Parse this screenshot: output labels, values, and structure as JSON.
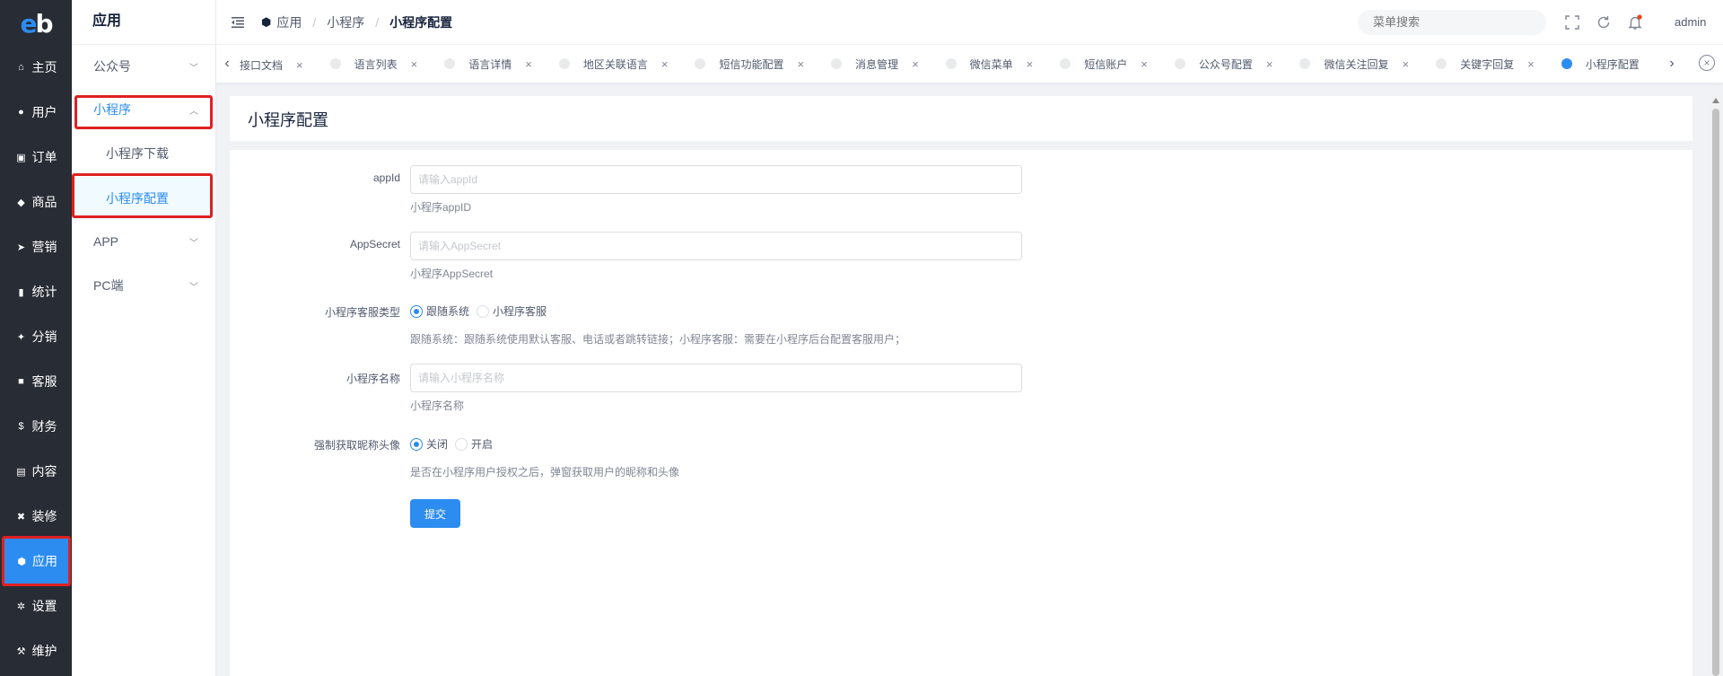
{
  "logo": {
    "text_e": "e",
    "text_b": "b"
  },
  "nav": [
    {
      "label": "主页",
      "icon": "home-icon",
      "glyph": "⌂"
    },
    {
      "label": "用户",
      "icon": "user-icon",
      "glyph": "●"
    },
    {
      "label": "订单",
      "icon": "cart-icon",
      "glyph": "▣"
    },
    {
      "label": "商品",
      "icon": "basket-icon",
      "glyph": "◆"
    },
    {
      "label": "营销",
      "icon": "send-icon",
      "glyph": "➤"
    },
    {
      "label": "统计",
      "icon": "bar-chart-icon",
      "glyph": "▮"
    },
    {
      "label": "分销",
      "icon": "handshake-icon",
      "glyph": "✦"
    },
    {
      "label": "客服",
      "icon": "chat-icon",
      "glyph": "■"
    },
    {
      "label": "财务",
      "icon": "dollar-icon",
      "glyph": "$"
    },
    {
      "label": "内容",
      "icon": "book-icon",
      "glyph": "▤"
    },
    {
      "label": "装修",
      "icon": "tools-icon",
      "glyph": "✖"
    },
    {
      "label": "应用",
      "icon": "cube-icon",
      "glyph": "⬢"
    },
    {
      "label": "设置",
      "icon": "gear-icon",
      "glyph": "✲"
    },
    {
      "label": "维护",
      "icon": "hammer-icon",
      "glyph": "⚒"
    }
  ],
  "subnav": {
    "title": "应用",
    "items": {
      "gongzhonghao": "公众号",
      "miniprogram": "小程序",
      "mp_download": "小程序下载",
      "mp_config": "小程序配置",
      "app": "APP",
      "pc": "PC端"
    }
  },
  "breadcrumb": {
    "b1": "应用",
    "b2": "小程序",
    "b3": "小程序配置",
    "sep": "/"
  },
  "header": {
    "search_placeholder": "菜单搜索",
    "user": "admin"
  },
  "tabs": [
    {
      "label": "接口文档",
      "active": false,
      "dot": false
    },
    {
      "label": "语言列表",
      "active": false,
      "dot": true
    },
    {
      "label": "语言详情",
      "active": false,
      "dot": true
    },
    {
      "label": "地区关联语言",
      "active": false,
      "dot": true
    },
    {
      "label": "短信功能配置",
      "active": false,
      "dot": true
    },
    {
      "label": "消息管理",
      "active": false,
      "dot": true
    },
    {
      "label": "微信菜单",
      "active": false,
      "dot": true
    },
    {
      "label": "短信账户",
      "active": false,
      "dot": true
    },
    {
      "label": "公众号配置",
      "active": false,
      "dot": true
    },
    {
      "label": "微信关注回复",
      "active": false,
      "dot": true
    },
    {
      "label": "关键字回复",
      "active": false,
      "dot": true
    },
    {
      "label": "小程序配置",
      "active": true,
      "dot": true
    }
  ],
  "page": {
    "title": "小程序配置"
  },
  "form": {
    "appid": {
      "label": "appId",
      "placeholder": "请输入appId",
      "help": "小程序appID"
    },
    "appsecret": {
      "label": "AppSecret",
      "placeholder": "请输入AppSecret",
      "help": "小程序AppSecret"
    },
    "service_type": {
      "label": "小程序客服类型",
      "options": [
        "跟随系统",
        "小程序客服"
      ],
      "selected": 0,
      "help": "跟随系统：跟随系统使用默认客服、电话或者跳转链接；小程序客服：需要在小程序后台配置客服用户；"
    },
    "name": {
      "label": "小程序名称",
      "placeholder": "请输入小程序名称",
      "help": "小程序名称"
    },
    "force_avatar": {
      "label": "强制获取昵称头像",
      "options": [
        "关闭",
        "开启"
      ],
      "selected": 0,
      "help": "是否在小程序用户授权之后，弹窗获取用户的昵称和头像"
    },
    "submit": "提交"
  },
  "colors": {
    "primary": "#2d8cf0",
    "sidebar": "#282c34",
    "highlight": "#e02020"
  }
}
